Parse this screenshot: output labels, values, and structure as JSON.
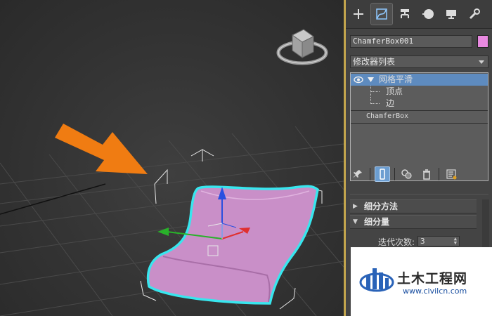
{
  "viewport": {
    "label": "perspective-viewport"
  },
  "command_panel": {
    "tabs": [
      {
        "name": "create",
        "icon": "plus-icon"
      },
      {
        "name": "modify",
        "icon": "modify-curve-icon"
      },
      {
        "name": "hierarchy",
        "icon": "hierarchy-icon"
      },
      {
        "name": "motion",
        "icon": "motion-icon"
      },
      {
        "name": "display",
        "icon": "display-monitor-icon"
      },
      {
        "name": "utilities",
        "icon": "wrench-icon"
      }
    ],
    "object_name": "ChamferBox001",
    "object_color": "#e889e0",
    "modifier_list_label": "修改器列表",
    "stack": {
      "modifier": "网格平滑",
      "sub_items": [
        "顶点",
        "边"
      ],
      "base_object": "ChamferBox"
    },
    "rollouts": {
      "subdivision_method": "细分方法",
      "subdivision_amount": "细分量"
    },
    "iterations": {
      "label": "迭代次数:",
      "value": "3"
    }
  },
  "watermark": {
    "title": "土木工程网",
    "url": "www.civilcn.com"
  },
  "colors": {
    "selection_outline": "#38e6ee",
    "object_fill": "#c98fc8",
    "arrow_annotation": "#f07c12",
    "stack_highlight": "#5e8bbf"
  }
}
